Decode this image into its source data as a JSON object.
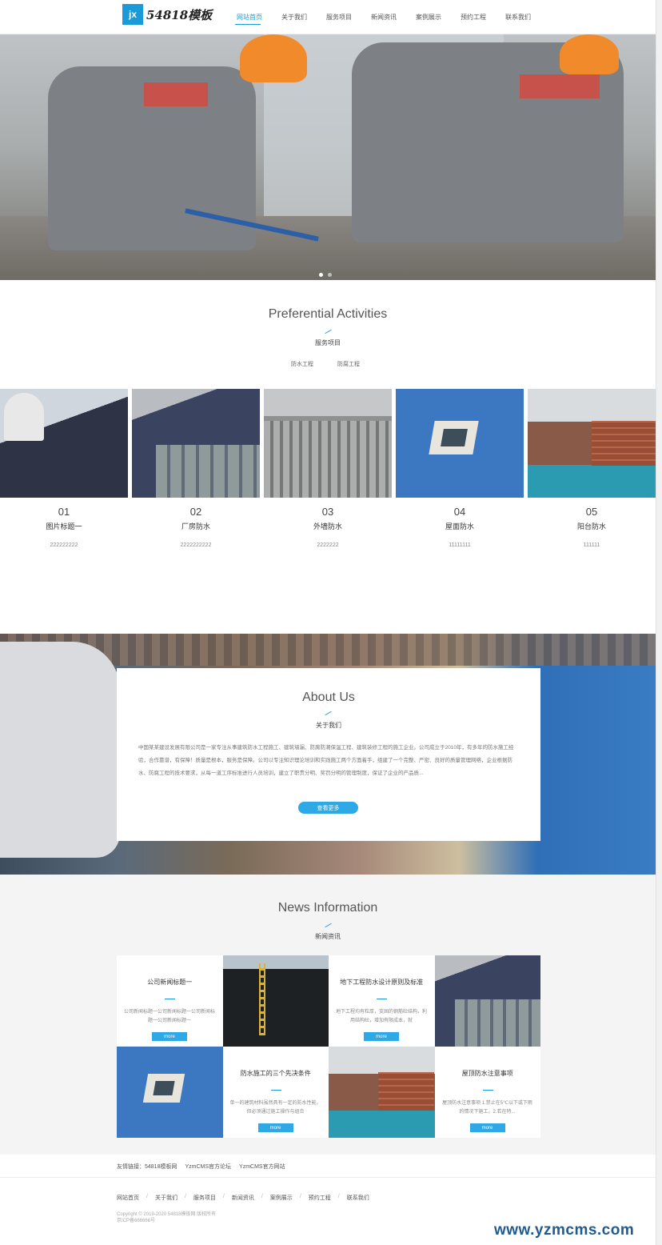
{
  "header": {
    "logo_mark": "jx",
    "logo_text": "54818模板",
    "nav": [
      "网站首页",
      "关于我们",
      "服务项目",
      "新闻资讯",
      "案例展示",
      "预约工程",
      "联系我们"
    ]
  },
  "hero": {
    "slides": 2,
    "active_slide": 1
  },
  "services": {
    "title": "Preferential Activities",
    "subtitle": "服务项目",
    "tabs": [
      "防水工程",
      "防腐工程"
    ],
    "items": [
      {
        "num": "01",
        "name": "图片标题一",
        "desc": "222222222"
      },
      {
        "num": "02",
        "name": "厂房防水",
        "desc": "2222222222"
      },
      {
        "num": "03",
        "name": "外墙防水",
        "desc": "2222222"
      },
      {
        "num": "04",
        "name": "屋面防水",
        "desc": "11111111"
      },
      {
        "num": "05",
        "name": "阳台防水",
        "desc": "111111"
      }
    ]
  },
  "about": {
    "title": "About Us",
    "subtitle": "关于我们",
    "text": "中国某某建设发展有限公司是一家专注从事建筑防水工程施工、建筑墙漏、防腐防潮保温工程、建筑装修工程的施工企业。公司成立于2010年，有多年的防水施工经验，合作靠谱，有保障！质量是根本，服务是保障。公司以专注知识理论培训和实践施工两个方面着手，组建了一个完整、严密、良好的质量管理网络，企业根据防水、防腐工程的技术要求，从每一道工序标准进行人员培训，建立了职责分明、奖罚分明的管理制度，保证了企业的产品质...",
    "button": "查看更多"
  },
  "news": {
    "title": "News Information",
    "subtitle": "新闻资讯",
    "items": [
      {
        "title": "公司新闻标题一",
        "excerpt": "公司新闻标题一公司新闻标题一公司新闻标题一公司新闻标题一",
        "more": "more"
      },
      {
        "title": "地下工程防水设计原则及标准",
        "excerpt": "地下工程均有粒厚，支固的钢筋砼结构，利用结构砼，增加有限成本，就",
        "more": "more"
      },
      {
        "title": "防水施工的三个先决条件",
        "excerpt": "单一的建筑材料虽然具有一定的防水性能，但必须通过施工操作与组合",
        "more": "more"
      },
      {
        "title": "屋顶防水注意事项",
        "excerpt": "屋顶防水注意事项 1.禁止在5℃以下或下雨的情况下施工。2.若在特...",
        "more": "more"
      }
    ]
  },
  "friends": {
    "label": "友情链接：",
    "links": [
      "54818模板网",
      "YzmCMS官方论坛",
      "YzmCMS官方网站"
    ]
  },
  "footer": {
    "nav": [
      "网站首页",
      "关于我们",
      "服务项目",
      "新闻资讯",
      "案例展示",
      "预约工程",
      "联系我们"
    ],
    "copyright": "Copyright © 2019-2020 54818模板网 版权所有",
    "icp": "京ICP备666666号"
  },
  "watermark": "www.yzmcms.com",
  "colors": {
    "accent": "#1a9bd7",
    "button": "#2fa8e6",
    "watermark": "#1f5b8e"
  }
}
